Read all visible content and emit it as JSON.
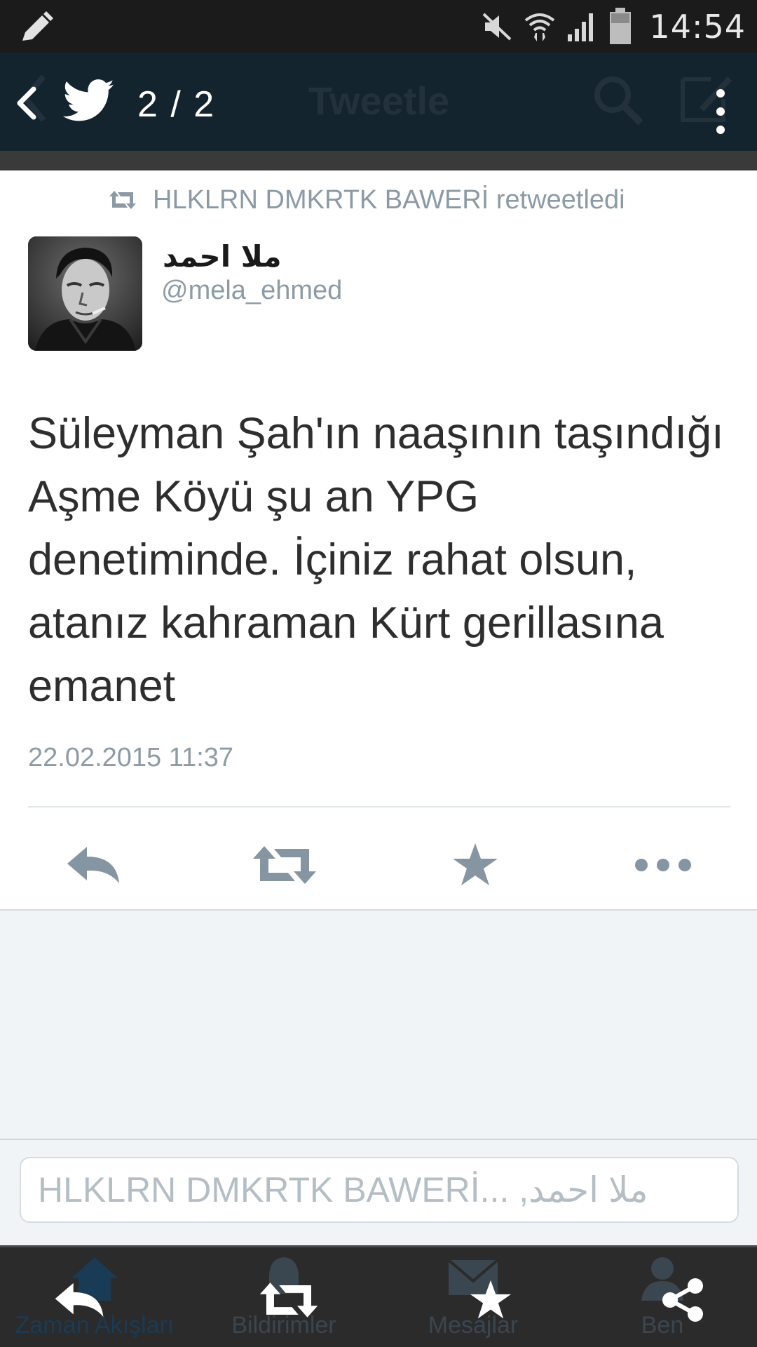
{
  "status_bar": {
    "time": "14:54",
    "icons": [
      "pencil-icon",
      "mute-icon",
      "wifi-icon",
      "signal-icon",
      "battery-icon"
    ]
  },
  "action_bar": {
    "counter": "2 / 2",
    "ghost_title": "Tweetle",
    "icons": [
      "back-icon",
      "twitter-bird-icon",
      "overflow-menu-icon"
    ]
  },
  "tweet": {
    "retweeted_by": "HLKLRN DMKRTK BAWERİ retweetledi",
    "display_name": "ملا احمد",
    "handle": "@mela_ehmed",
    "text": "Süleyman Şah'ın naaşının taşındığı Aşme Köyü şu an YPG denetiminde. İçiniz rahat olsun, atanız kahraman Kürt gerillasına emanet",
    "timestamp": "22.02.2015 11:37",
    "actions": [
      "reply-icon",
      "retweet-icon",
      "favorite-icon",
      "more-icon"
    ]
  },
  "reply": {
    "placeholder": "HLKLRN DMKRTK BAWERİ... ,ملا احمد"
  },
  "bottom_bar": {
    "tabs": [
      {
        "label": "Zaman Akışları",
        "active": true
      },
      {
        "label": "Bildirimler",
        "active": false
      },
      {
        "label": "Mesajlar",
        "active": false
      },
      {
        "label": "Ben",
        "active": false
      }
    ],
    "buttons": [
      "reply-icon",
      "retweet-icon",
      "favorite-icon",
      "share-icon"
    ]
  },
  "colors": {
    "action_bar": "#14242f",
    "status_bar": "#1b1b1b",
    "secondary_text": "#8d9ba5",
    "icon_gray": "#8596a2"
  }
}
